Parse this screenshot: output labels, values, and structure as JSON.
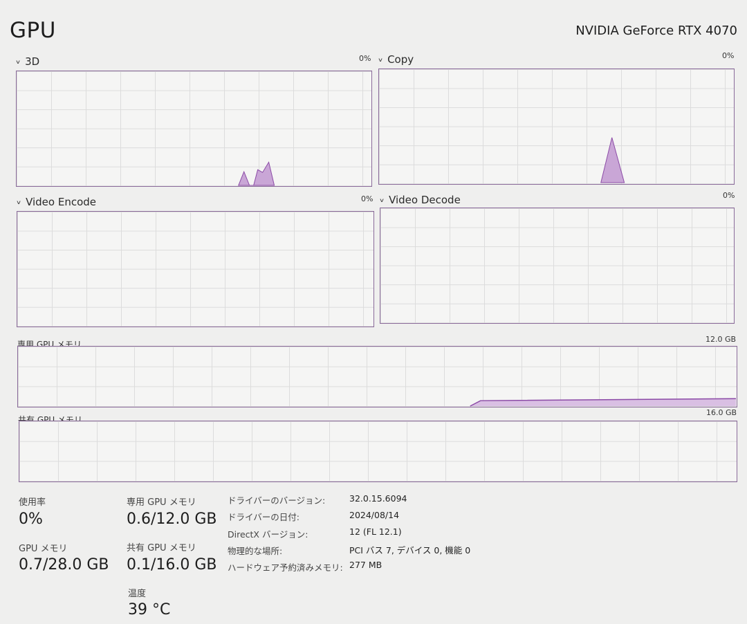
{
  "header": {
    "title": "GPU",
    "gpu_name": "NVIDIA GeForce RTX 4070"
  },
  "engines": [
    {
      "label": "3D",
      "percent": "0%"
    },
    {
      "label": "Copy",
      "percent": "0%"
    },
    {
      "label": "Video Encode",
      "percent": "0%"
    },
    {
      "label": "Video Decode",
      "percent": "0%"
    }
  ],
  "memory_graphs": {
    "dedicated": {
      "label": "専用 GPU メモリ",
      "capacity": "12.0 GB"
    },
    "shared": {
      "label": "共有 GPU メモリ",
      "capacity": "16.0 GB"
    }
  },
  "stats": {
    "utilization": {
      "label": "使用率",
      "value": "0%"
    },
    "dedicated_mem": {
      "label": "専用 GPU メモリ",
      "value": "0.6/12.0 GB"
    },
    "gpu_mem": {
      "label": "GPU メモリ",
      "value": "0.7/28.0 GB"
    },
    "shared_mem": {
      "label": "共有 GPU メモリ",
      "value": "0.1/16.0 GB"
    },
    "temperature": {
      "label": "温度",
      "value": "39 °C"
    }
  },
  "details": [
    {
      "key": "ドライバーのバージョン:",
      "value": "32.0.15.6094"
    },
    {
      "key": "ドライバーの日付:",
      "value": "2024/08/14"
    },
    {
      "key": "DirectX バージョン:",
      "value": "12 (FL 12.1)"
    },
    {
      "key": "物理的な場所:",
      "value": "PCI バス 7, デバイス 0, 機能 0"
    },
    {
      "key": "ハードウェア予約済みメモリ:",
      "value": "277 MB"
    }
  ],
  "colors": {
    "graph_border": "#8a6a9a",
    "graph_fill": "#c9a6d6",
    "graph_line": "#8b4aa6"
  }
}
